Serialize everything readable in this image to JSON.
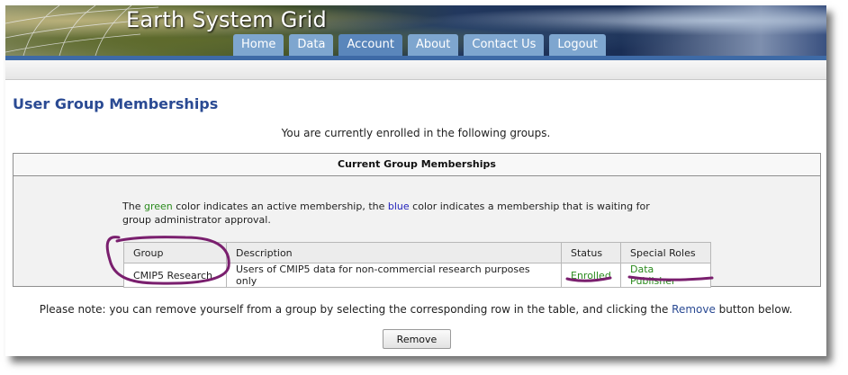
{
  "header": {
    "site_title": "Earth System Grid",
    "nav_tabs": [
      "Home",
      "Data",
      "Account",
      "About",
      "Contact Us",
      "Logout"
    ],
    "active_tab": "Account"
  },
  "page": {
    "title": "User Group Memberships",
    "intro": "You are currently enrolled in the following groups."
  },
  "panel": {
    "header": "Current Group Memberships",
    "legend_part1": "The ",
    "legend_green": "green",
    "legend_part2": " color indicates an active membership, the ",
    "legend_blue": "blue",
    "legend_part3": " color indicates a membership that is waiting for group administrator approval."
  },
  "table": {
    "columns": [
      "Group",
      "Description",
      "Status",
      "Special Roles"
    ],
    "rows": [
      {
        "group": "CMIP5 Research",
        "description": "Users of CMIP5 data for non-commercial research purposes only",
        "status": "Enrolled",
        "special_roles": "Data Publisher"
      }
    ]
  },
  "note": {
    "before": "Please note: you can remove yourself from a group by selecting the corresponding row in the table, and clicking the ",
    "link": "Remove",
    "after": " button below."
  },
  "remove_button_label": "Remove",
  "colors": {
    "active_membership": "#2a8a1d",
    "pending_membership": "#2222bb",
    "title_blue": "#2a4a93",
    "annotation": "#7a1f6e"
  }
}
